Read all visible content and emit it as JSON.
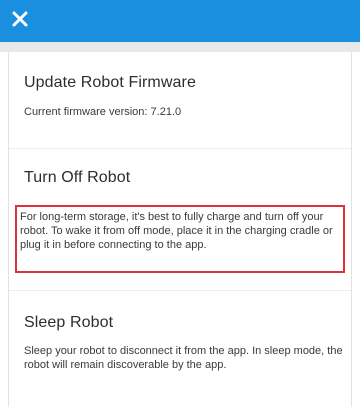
{
  "header": {
    "close_icon": "close-icon",
    "background_color": "#1a8fe0"
  },
  "sections": [
    {
      "title": "Update Robot Firmware",
      "text": "Current firmware version: 7.21.0"
    },
    {
      "title": "Turn Off Robot",
      "text": "For long-term storage, it's best to fully charge and turn off your robot. To wake it from off mode, place it in the charging cradle or plug it in before connecting to the app.",
      "highlight_color": "#e0303a"
    },
    {
      "title": "Sleep Robot",
      "text": "Sleep your robot to disconnect it from the app. In sleep mode, the robot will remain discoverable by the app."
    }
  ]
}
